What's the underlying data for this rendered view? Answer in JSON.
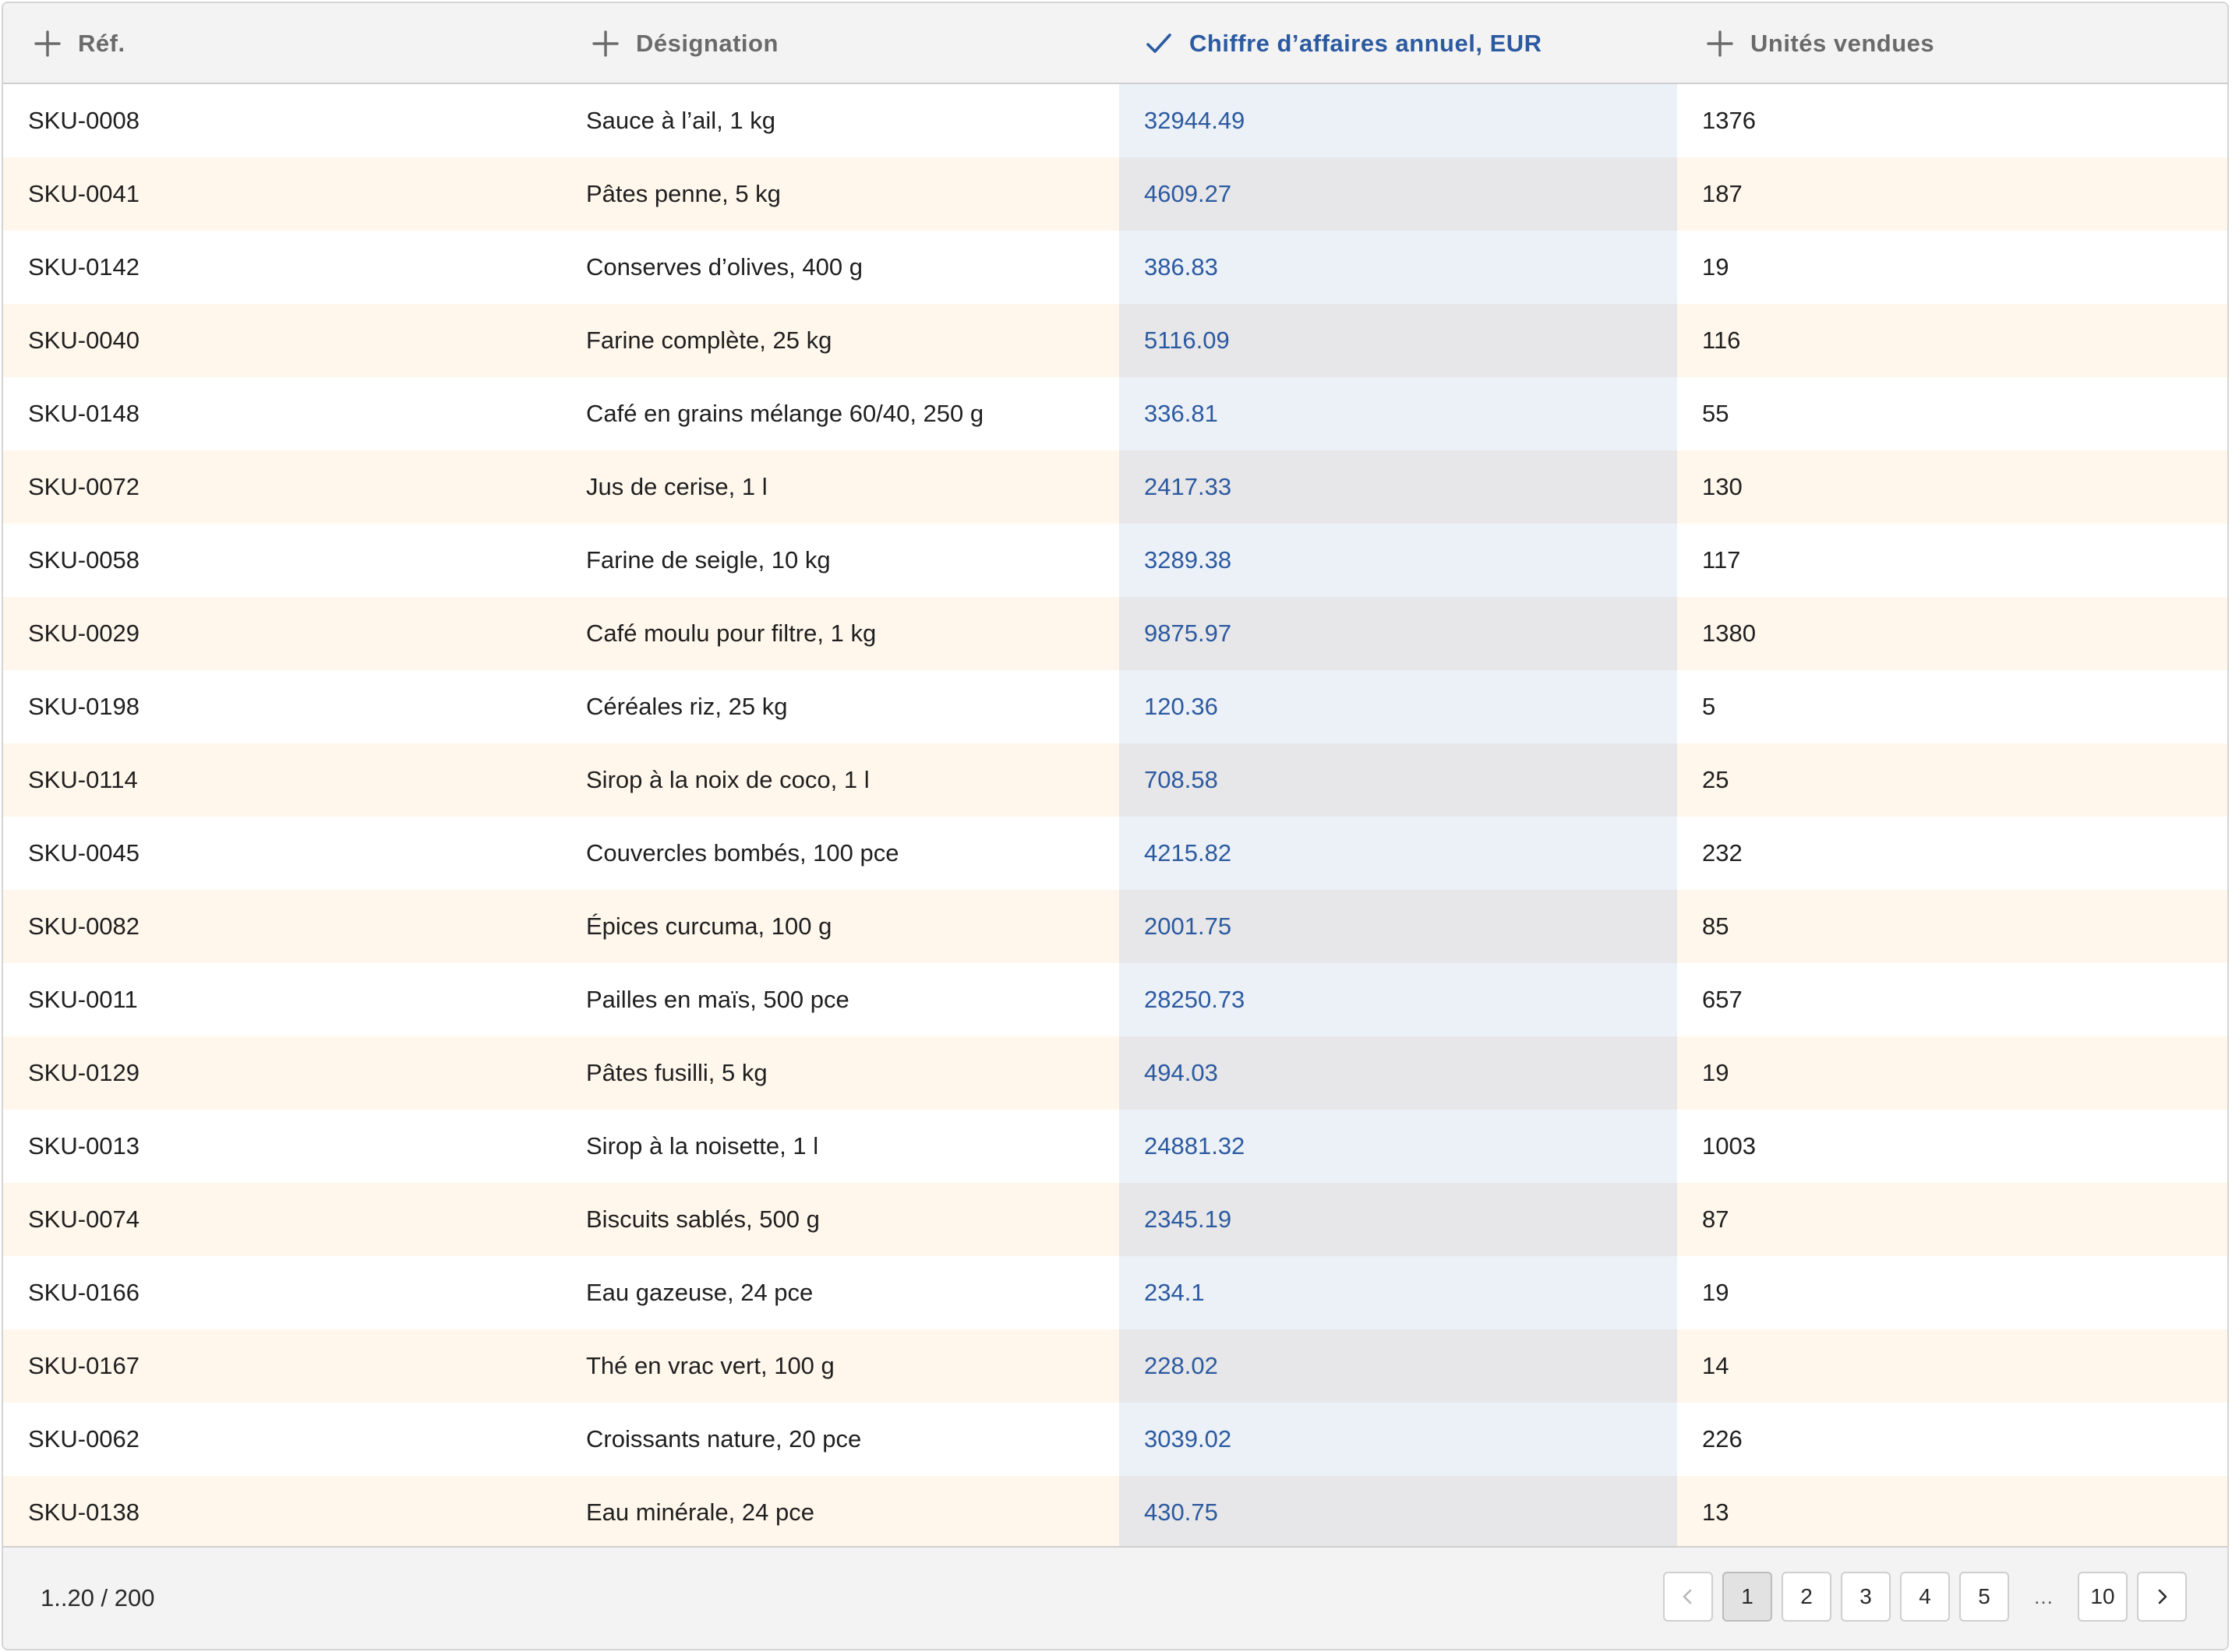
{
  "columns": [
    {
      "key": "ref",
      "label": "Réf.",
      "icon": "plus-icon",
      "active": false
    },
    {
      "key": "name",
      "label": "Désignation",
      "icon": "plus-icon",
      "active": false
    },
    {
      "key": "revenue",
      "label": "Chiffre d’affaires annuel, EUR",
      "icon": "check-icon",
      "active": true
    },
    {
      "key": "units",
      "label": "Unités vendues",
      "icon": "plus-icon",
      "active": false
    }
  ],
  "rows": [
    {
      "ref": "SKU-0008",
      "name": "Sauce à l’ail, 1 kg",
      "revenue": "32944.49",
      "units": "1376"
    },
    {
      "ref": "SKU-0041",
      "name": "Pâtes penne, 5 kg",
      "revenue": "4609.27",
      "units": "187"
    },
    {
      "ref": "SKU-0142",
      "name": "Conserves d’olives, 400 g",
      "revenue": "386.83",
      "units": "19"
    },
    {
      "ref": "SKU-0040",
      "name": "Farine complète, 25 kg",
      "revenue": "5116.09",
      "units": "116"
    },
    {
      "ref": "SKU-0148",
      "name": "Café en grains mélange 60/40, 250 g",
      "revenue": "336.81",
      "units": "55"
    },
    {
      "ref": "SKU-0072",
      "name": "Jus de cerise, 1 l",
      "revenue": "2417.33",
      "units": "130"
    },
    {
      "ref": "SKU-0058",
      "name": "Farine de seigle, 10 kg",
      "revenue": "3289.38",
      "units": "117"
    },
    {
      "ref": "SKU-0029",
      "name": "Café moulu pour filtre, 1 kg",
      "revenue": "9875.97",
      "units": "1380"
    },
    {
      "ref": "SKU-0198",
      "name": "Céréales riz, 25 kg",
      "revenue": "120.36",
      "units": "5"
    },
    {
      "ref": "SKU-0114",
      "name": "Sirop à la noix de coco, 1 l",
      "revenue": "708.58",
      "units": "25"
    },
    {
      "ref": "SKU-0045",
      "name": "Couvercles bombés, 100 pce",
      "revenue": "4215.82",
      "units": "232"
    },
    {
      "ref": "SKU-0082",
      "name": "Épices curcuma, 100 g",
      "revenue": "2001.75",
      "units": "85"
    },
    {
      "ref": "SKU-0011",
      "name": "Pailles en maïs, 500 pce",
      "revenue": "28250.73",
      "units": "657"
    },
    {
      "ref": "SKU-0129",
      "name": "Pâtes fusilli, 5 kg",
      "revenue": "494.03",
      "units": "19"
    },
    {
      "ref": "SKU-0013",
      "name": "Sirop à la noisette, 1 l",
      "revenue": "24881.32",
      "units": "1003"
    },
    {
      "ref": "SKU-0074",
      "name": "Biscuits sablés, 500 g",
      "revenue": "2345.19",
      "units": "87"
    },
    {
      "ref": "SKU-0166",
      "name": "Eau gazeuse, 24 pce",
      "revenue": "234.1",
      "units": "19"
    },
    {
      "ref": "SKU-0167",
      "name": "Thé en vrac vert, 100 g",
      "revenue": "228.02",
      "units": "14"
    },
    {
      "ref": "SKU-0062",
      "name": "Croissants nature, 20 pce",
      "revenue": "3039.02",
      "units": "226"
    },
    {
      "ref": "SKU-0138",
      "name": "Eau minérale, 24 pce",
      "revenue": "430.75",
      "units": "13"
    }
  ],
  "footer": {
    "summary": "1..20 / 200",
    "pages": [
      "1",
      "2",
      "3",
      "4",
      "5"
    ],
    "current_page": "1",
    "ellipsis": "…",
    "last_page": "10",
    "prev_icon": "chevron-left-icon",
    "next_icon": "chevron-right-icon"
  },
  "colors": {
    "accent": "#2c5aa0",
    "header_bg": "#f3f3f3",
    "row_alt_bg": "#fff7ec",
    "sorted_col_bg": "#ecf1f8"
  }
}
